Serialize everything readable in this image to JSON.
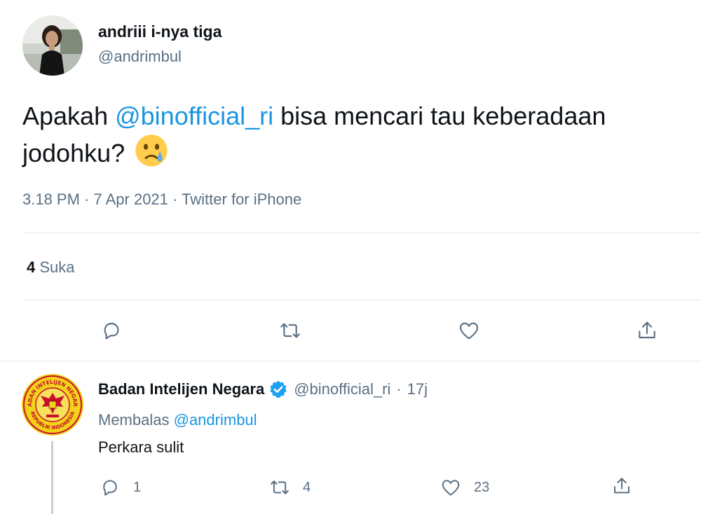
{
  "tweet": {
    "author_name": "andriii i-nya tiga",
    "author_handle": "@andrimbul",
    "text_before": "Apakah ",
    "mention": "@binofficial_ri",
    "text_after": " bisa mencari tau keberadaan jodohku?",
    "emoji": "crying-face-emoji",
    "meta": "3.18 PM · 7 Apr 2021 · Twitter for iPhone",
    "likes_count": "4",
    "likes_label": "Suka",
    "icons": [
      "reply-icon",
      "retweet-icon",
      "like-icon",
      "share-icon"
    ]
  },
  "reply": {
    "author_name": "Badan Intelijen Negara",
    "author_handle": "@binofficial_ri",
    "separator": "·",
    "time": "17j",
    "replying_label": "Membalas",
    "replying_to": "@andrimbul",
    "text": "Perkara sulit",
    "reply_count": "1",
    "retweet_count": "4",
    "like_count": "23",
    "logo_text_top": "BADAN INTELIJEN NEGARA",
    "logo_text_bottom": "REPUBLIK INDONESIA"
  },
  "colors": {
    "link": "#1b95e0",
    "muted": "#5b7083",
    "divider": "#e6ecf0",
    "verified": "#1da1f2",
    "logo_yellow": "#f2d21a",
    "logo_red": "#c8102e"
  }
}
